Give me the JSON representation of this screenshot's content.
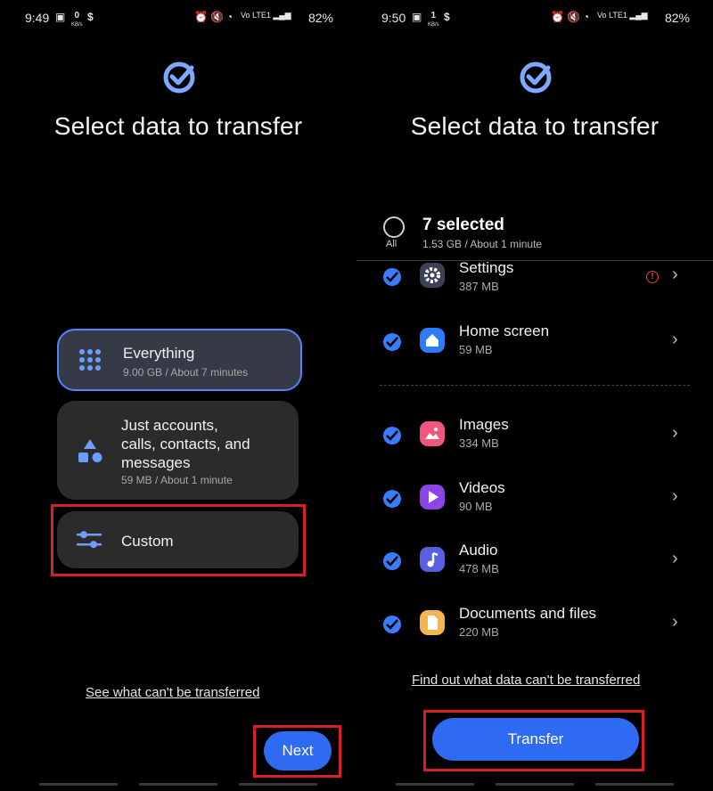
{
  "left": {
    "status": {
      "time": "9:49",
      "kbs_value": "0",
      "kbs_unit": "KB/s",
      "battery": "82%"
    },
    "title": "Select data to transfer",
    "options": [
      {
        "label": "Everything",
        "sub": "9.00 GB / About 7 minutes"
      },
      {
        "label": "Just accounts, calls, contacts, and messages",
        "label_lines": [
          "Just accounts,",
          "calls, contacts, and",
          "messages"
        ],
        "sub": "59 MB / About 1 minute"
      },
      {
        "label": "Custom",
        "sub": ""
      }
    ],
    "link": "See what can't be transferred",
    "next_button": "Next"
  },
  "right": {
    "status": {
      "time": "9:50",
      "kbs_value": "1",
      "kbs_unit": "KB/s",
      "battery": "82%"
    },
    "title": "Select data to transfer",
    "select_all_label": "All",
    "selected_title": "7 selected",
    "selected_sub": "1.53 GB / About 1 minute",
    "items": [
      {
        "name": "Settings",
        "size": "387 MB",
        "icon": "settings-gear-icon",
        "color": "#3b3f57",
        "warning": true
      },
      {
        "name": "Home screen",
        "size": "59 MB",
        "icon": "home-icon",
        "color": "#2f7bff",
        "warning": false
      },
      {
        "name": "Images",
        "size": "334 MB",
        "icon": "images-icon",
        "color": "#f2557d",
        "warning": false
      },
      {
        "name": "Videos",
        "size": "90 MB",
        "icon": "video-play-icon",
        "color": "#8b44e6",
        "warning": false
      },
      {
        "name": "Audio",
        "size": "478 MB",
        "icon": "audio-note-icon",
        "color": "#5860e0",
        "warning": false
      },
      {
        "name": "Documents and files",
        "size": "220 MB",
        "icon": "document-icon",
        "color": "#f2b64a",
        "warning": false
      }
    ],
    "link": "Find out what data can't be transferred",
    "transfer_button": "Transfer"
  },
  "colors": {
    "accent": "#2f6bf2",
    "highlight": "#d81f26",
    "check": "#3b7cff"
  }
}
